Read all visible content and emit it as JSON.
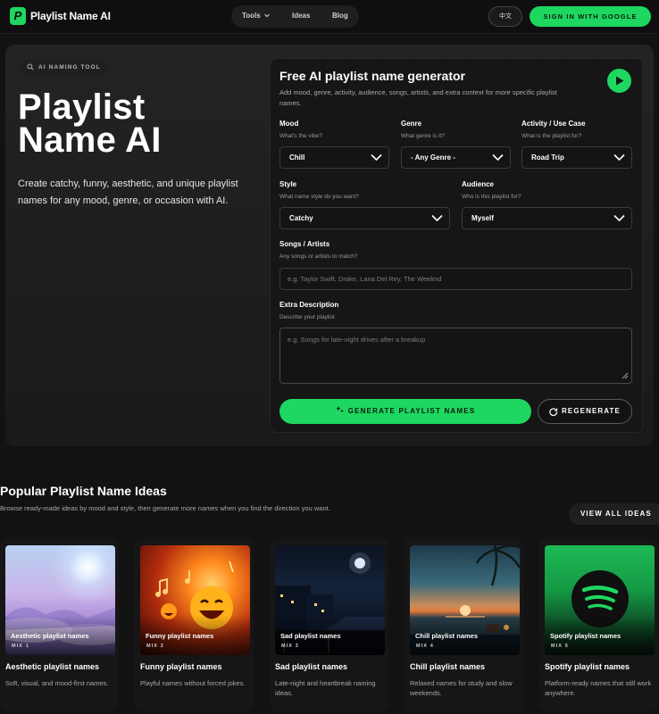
{
  "nav": {
    "logo_letter": "P",
    "brand": "Playlist Name AI",
    "links": [
      "Tools",
      "Ideas",
      "Blog"
    ],
    "lang": "中文",
    "signin": "SIGN IN WITH GOOGLE"
  },
  "hero": {
    "tag": "AI NAMING TOOL",
    "title_line1": "Playlist",
    "title_line2": "Name AI",
    "description": "Create catchy, funny, aesthetic, and unique playlist names for any mood, genre, or occasion with AI."
  },
  "generator": {
    "title": "Free AI playlist name generator",
    "subtitle": "Add mood, genre, activity, audience, songs, artists, and extra context for more specific playlist names.",
    "mood": {
      "label": "Mood",
      "hint": "What's the vibe?",
      "value": "Chill"
    },
    "genre": {
      "label": "Genre",
      "hint": "What genre is it?",
      "value": "- Any Genre -"
    },
    "activity": {
      "label": "Activity / Use Case",
      "hint": "What is the playlist for?",
      "value": "Road Trip"
    },
    "style": {
      "label": "Style",
      "hint": "What name style do you want?",
      "value": "Catchy"
    },
    "audience": {
      "label": "Audience",
      "hint": "Who is this playlist for?",
      "value": "Myself"
    },
    "songs": {
      "label": "Songs / Artists",
      "hint": "Any songs or artists to match?",
      "placeholder": "e.g. Taylor Swift, Drake, Lana Del Rey, The Weeknd"
    },
    "extra": {
      "label": "Extra Description",
      "hint": "Describe your playlist",
      "placeholder": "e.g. Songs for late-night drives after a breakup"
    },
    "generate_label": "GENERATE PLAYLIST NAMES",
    "regenerate_label": "REGENERATE",
    "accent": "#1ed760"
  },
  "popular": {
    "title": "Popular Playlist Name Ideas",
    "subtitle": "Browse ready-made ideas by mood and style, then generate more names when you find the direction you want.",
    "view_all": "VIEW ALL IDEAS",
    "cards": [
      {
        "thumb_title": "Aesthetic playlist names",
        "mix": "MIX 1",
        "title": "Aesthetic playlist names",
        "desc": "Soft, visual, and mood-first names."
      },
      {
        "thumb_title": "Funny playlist names",
        "mix": "MIX 2",
        "title": "Funny playlist names",
        "desc": "Playful names without forced jokes."
      },
      {
        "thumb_title": "Sad playlist names",
        "mix": "MIX 3",
        "title": "Sad playlist names",
        "desc": "Late-night and heartbreak naming ideas."
      },
      {
        "thumb_title": "Chill playlist names",
        "mix": "MIX 4",
        "title": "Chill playlist names",
        "desc": "Relaxed names for study and slow weekends."
      },
      {
        "thumb_title": "Spotify playlist names",
        "mix": "MIX 5",
        "title": "Spotify playlist names",
        "desc": "Platform-ready names that still work anywhere."
      }
    ]
  }
}
